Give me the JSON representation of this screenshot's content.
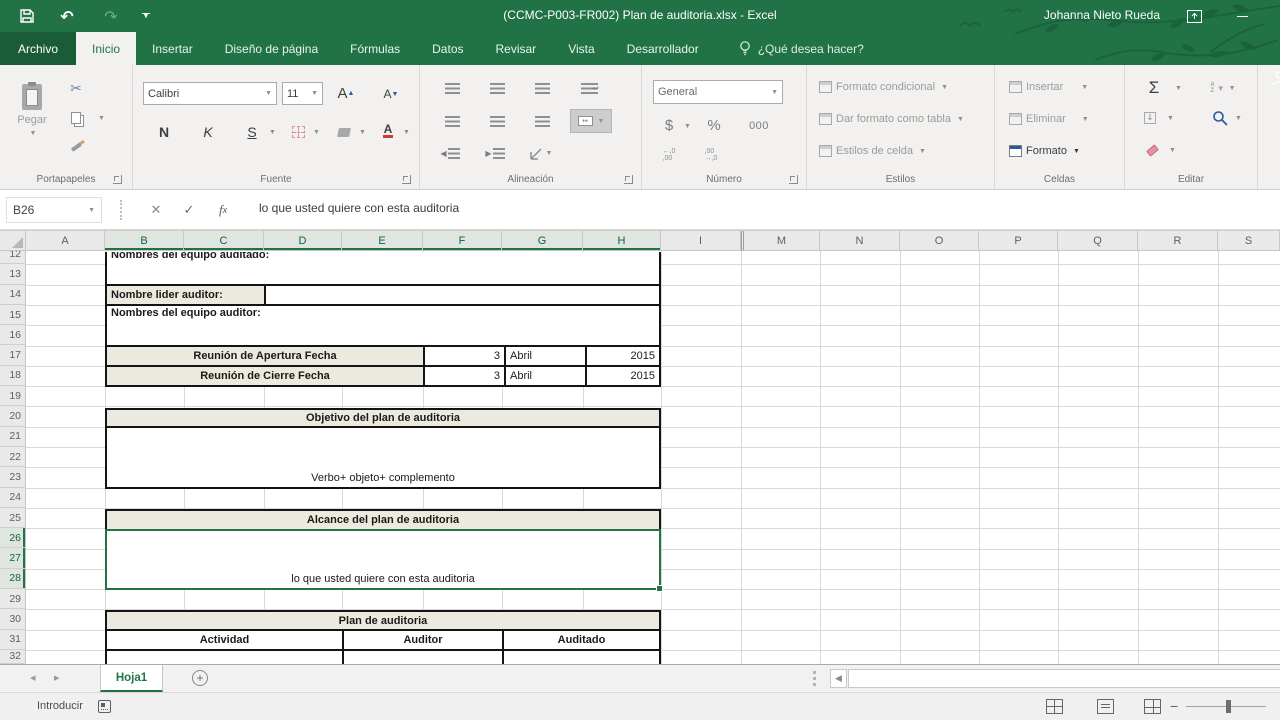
{
  "title_bar": {
    "title": "(CCMC-P003-FR002) Plan de auditoria.xlsx  -  Excel",
    "user": "Johanna Nieto Rueda"
  },
  "ribbon": {
    "tabs": [
      "Archivo",
      "Inicio",
      "Insertar",
      "Diseño de página",
      "Fórmulas",
      "Datos",
      "Revisar",
      "Vista",
      "Desarrollador"
    ],
    "tell_me": "¿Qué desea hacer?",
    "portapapeles": {
      "label": "Portapapeles",
      "paste": "Pegar"
    },
    "fuente": {
      "label": "Fuente",
      "font": "Calibri",
      "size": "11",
      "bold": "N",
      "italic": "K",
      "underline": "S"
    },
    "alineacion": {
      "label": "Alineación"
    },
    "numero": {
      "label": "Número",
      "format": "General",
      "dollar": "$",
      "percent": "%",
      "thousands": "000"
    },
    "estilos": {
      "label": "Estilos",
      "conditional": "Formato condicional",
      "format_table": "Dar formato como tabla",
      "cell_styles": "Estilos de celda"
    },
    "celdas": {
      "label": "Celdas",
      "insert": "Insertar",
      "delete": "Eliminar",
      "format": "Formato"
    },
    "editar": {
      "label": "Editar"
    }
  },
  "formula_bar": {
    "cell_ref": "B26",
    "formula": "lo que usted quiere con esta auditoria"
  },
  "grid": {
    "columns": [
      {
        "label": "A",
        "width": 79
      },
      {
        "label": "B",
        "width": 79,
        "selected": true
      },
      {
        "label": "C",
        "width": 80,
        "selected": true
      },
      {
        "label": "D",
        "width": 78,
        "selected": true
      },
      {
        "label": "E",
        "width": 81,
        "selected": true
      },
      {
        "label": "F",
        "width": 79,
        "selected": true
      },
      {
        "label": "G",
        "width": 81,
        "selected": true
      },
      {
        "label": "H",
        "width": 78,
        "selected": true
      },
      {
        "label": "I",
        "width": 80
      },
      {
        "label": "M",
        "width": 79,
        "hidden_before": true
      },
      {
        "label": "N",
        "width": 80
      },
      {
        "label": "O",
        "width": 79
      },
      {
        "label": "P",
        "width": 79
      },
      {
        "label": "Q",
        "width": 80
      },
      {
        "label": "R",
        "width": 80
      },
      {
        "label": "S",
        "width": 62
      }
    ],
    "rows": [
      {
        "label": "12",
        "height": 13.3,
        "clip_top": true
      },
      {
        "label": "13",
        "height": 20.3
      },
      {
        "label": "14",
        "height": 20.3
      },
      {
        "label": "15",
        "height": 20.3
      },
      {
        "label": "16",
        "height": 20.3
      },
      {
        "label": "17",
        "height": 20.3
      },
      {
        "label": "18",
        "height": 20.3
      },
      {
        "label": "19",
        "height": 20.3
      },
      {
        "label": "20",
        "height": 20.3
      },
      {
        "label": "21",
        "height": 20.3
      },
      {
        "label": "22",
        "height": 20.3
      },
      {
        "label": "23",
        "height": 20.3
      },
      {
        "label": "24",
        "height": 20.3
      },
      {
        "label": "25",
        "height": 20.3
      },
      {
        "label": "26",
        "height": 20.3,
        "selected": true
      },
      {
        "label": "27",
        "height": 20.3,
        "selected": true
      },
      {
        "label": "28",
        "height": 20.3,
        "selected": true
      },
      {
        "label": "29",
        "height": 20.3
      },
      {
        "label": "30",
        "height": 20.3
      },
      {
        "label": "31",
        "height": 20.3
      },
      {
        "label": "32",
        "height": 14
      }
    ],
    "cells": {
      "equipo_auditado": "Nombres del equipo auditado:",
      "lider_auditor": "Nombre lider auditor:",
      "equipo_auditor": "Nombres del equipo auditor:",
      "apertura_label": "Reunión de Apertura Fecha",
      "apertura_dia": "3",
      "apertura_mes": "Abril",
      "apertura_anio": "2015",
      "cierre_label": "Reunión de Cierre Fecha",
      "cierre_dia": "3",
      "cierre_mes": "Abril",
      "cierre_anio": "2015",
      "objetivo_header": "Objetivo  del plan de auditoria",
      "objetivo_hint": "Verbo+ objeto+ complemento",
      "alcance_header": "Alcance del plan de auditoria",
      "alcance_hint": "lo que usted quiere con esta auditoria",
      "plan_header": "Plan de auditoria",
      "col_actividad": "Actividad",
      "col_auditor": "Auditor",
      "col_auditado": "Auditado"
    }
  },
  "sheet_tabs": {
    "active": "Hoja1"
  },
  "status_bar": {
    "mode": "Introducir"
  },
  "colors": {
    "accent_green": "#217346",
    "header_cell_fill": "#ece9df",
    "selection_border": "#217346"
  }
}
